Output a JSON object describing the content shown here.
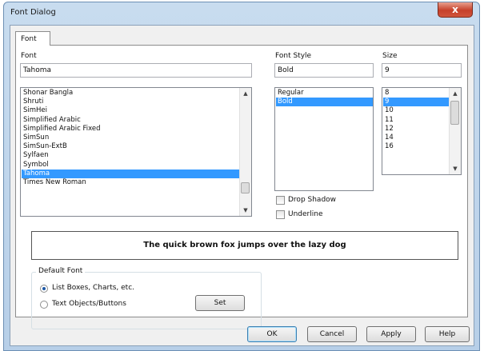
{
  "window": {
    "title": "Font Dialog",
    "close_label": "x"
  },
  "tabs": [
    {
      "label": "Font"
    }
  ],
  "font": {
    "label": "Font",
    "value": "Tahoma",
    "list": [
      "Shonar Bangla",
      "Shruti",
      "SimHei",
      "Simplified Arabic",
      "Simplified Arabic Fixed",
      "SimSun",
      "SimSun-ExtB",
      "Sylfaen",
      "Symbol",
      "Tahoma",
      "Times New Roman"
    ],
    "selected": "Tahoma"
  },
  "style": {
    "label": "Font Style",
    "value": "Bold",
    "list": [
      "Regular",
      "Bold"
    ],
    "selected": "Bold"
  },
  "size": {
    "label": "Size",
    "value": "9",
    "list": [
      "8",
      "9",
      "10",
      "11",
      "12",
      "14",
      "16"
    ],
    "selected": "9"
  },
  "effects": {
    "drop_shadow": {
      "label": "Drop Shadow",
      "checked": false
    },
    "underline": {
      "label": "Underline",
      "checked": false
    }
  },
  "preview_text": "The quick brown fox jumps over the lazy dog",
  "default_font": {
    "title": "Default Font",
    "options": [
      {
        "label": "List Boxes, Charts, etc.",
        "selected": true
      },
      {
        "label": "Text Objects/Buttons",
        "selected": false
      }
    ],
    "set_label": "Set"
  },
  "buttons": {
    "ok": "OK",
    "cancel": "Cancel",
    "apply": "Apply",
    "help": "Help"
  },
  "colors": {
    "selection": "#3399ff",
    "title_bar": "#b7cfe8",
    "close_button": "#c6402a"
  }
}
